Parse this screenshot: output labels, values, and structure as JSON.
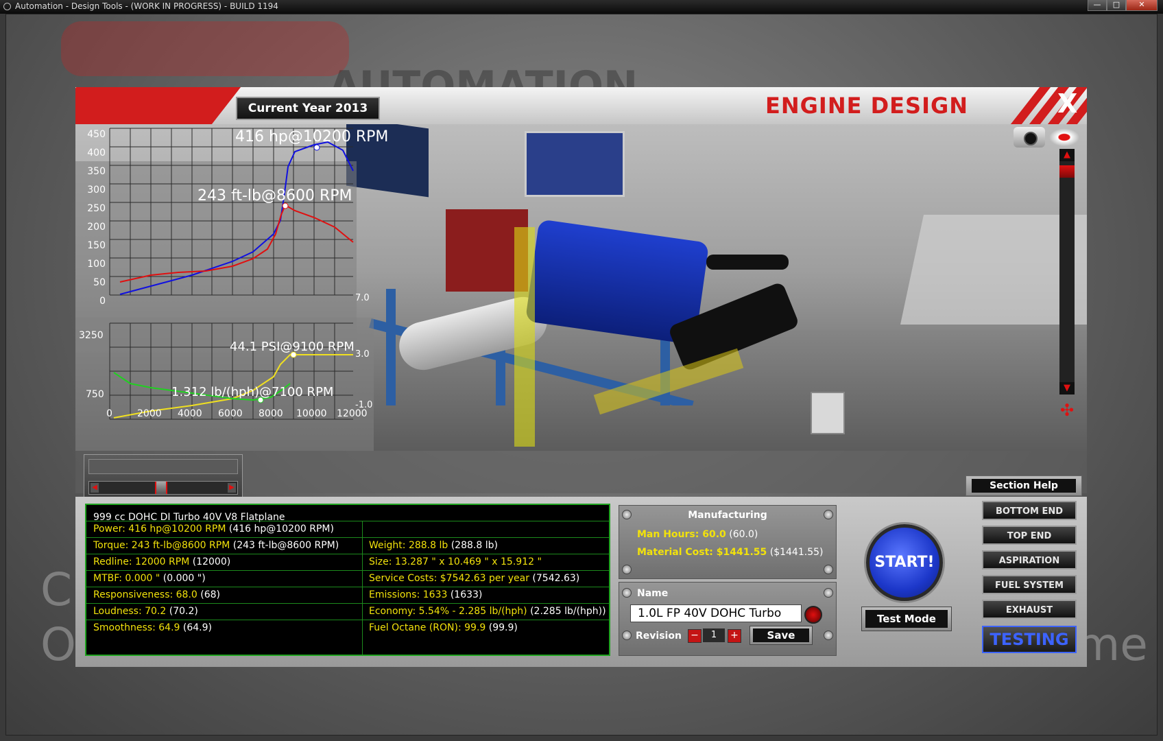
{
  "window": {
    "title": "Automation - Design Tools - (WORK IN PROGRESS) - BUILD 1194"
  },
  "background": {
    "logo_text": "AUTOMATION",
    "left_text_1": "C",
    "left_text_2": "O",
    "right_text": "me"
  },
  "header": {
    "year_label": "Current Year 2013",
    "title": "ENGINE DESIGN",
    "close_label": "X"
  },
  "power_graph": {
    "y_ticks": [
      "450",
      "400",
      "350",
      "300",
      "250",
      "200",
      "150",
      "100",
      "50",
      "0"
    ],
    "hp_annotation": "416 hp@10200 RPM",
    "torque_annotation": "243 ft-lb@8600 RPM",
    "colors": {
      "hp": "#1010e0",
      "torque": "#e01010"
    }
  },
  "boost_graph": {
    "left_ticks": [
      "3250",
      "750"
    ],
    "right_ticks": [
      "7.0",
      "3.0",
      "-1.0"
    ],
    "x_ticks": [
      "0",
      "2000",
      "4000",
      "6000",
      "8000",
      "10000",
      "12000"
    ],
    "boost_annotation": "44.1 PSI@9100 RPM",
    "fuel_annotation": "1.312 lb/(hph)@7100 RPM",
    "colors": {
      "boost": "#f0e020",
      "fuel": "#20d020"
    }
  },
  "section_help": {
    "label": "Section Help"
  },
  "stats": {
    "header": "999 cc DOHC DI Turbo 40V V8 Flatplane",
    "power": {
      "label": "Power: 416 hp@10200 RPM",
      "value": "(416 hp@10200 RPM)"
    },
    "torque": {
      "label": "Torque: 243 ft-lb@8600 RPM",
      "value": "(243 ft-lb@8600 RPM)"
    },
    "redline": {
      "label": "Redline: 12000 RPM",
      "value": "(12000)"
    },
    "mtbf": {
      "label": "MTBF: 0.000 \"",
      "value": "(0.000 \")"
    },
    "responsiveness": {
      "label": "Responsiveness: 68.0",
      "value": "(68)"
    },
    "loudness": {
      "label": "Loudness: 70.2",
      "value": "(70.2)"
    },
    "smoothness": {
      "label": "Smoothness: 64.9",
      "value": "(64.9)"
    },
    "weight": {
      "label": "Weight: 288.8 lb",
      "value": "(288.8 lb)"
    },
    "size": {
      "label": "Size: 13.287 \" x 10.469 \" x 15.912 \""
    },
    "service": {
      "label": "Service Costs: $7542.63 per year",
      "value": "(7542.63)"
    },
    "emissions": {
      "label": "Emissions: 1633",
      "value": "(1633)"
    },
    "economy": {
      "label": "Economy: 5.54% - 2.285 lb/(hph)",
      "value": "(2.285 lb/(hph))"
    },
    "octane": {
      "label": "Fuel Octane (RON): 99.9",
      "value": "(99.9)"
    }
  },
  "manufacturing": {
    "title": "Manufacturing",
    "man_hours": {
      "label": "Man Hours: 60.0",
      "value": "(60.0)"
    },
    "material_cost": {
      "label": "Material Cost: $1441.55",
      "value": "($1441.55)"
    }
  },
  "name_panel": {
    "title": "Name",
    "name_value": "1.0L FP 40V DOHC Turbo",
    "revision_label": "Revision",
    "revision_value": "1",
    "save_label": "Save"
  },
  "actions": {
    "start_label": "START!",
    "test_mode_label": "Test Mode"
  },
  "sections": {
    "bottom_end": "BOTTOM END",
    "top_end": "TOP END",
    "aspiration": "ASPIRATION",
    "fuel_system": "FUEL SYSTEM",
    "exhaust": "EXHAUST",
    "testing": "TESTING"
  }
}
